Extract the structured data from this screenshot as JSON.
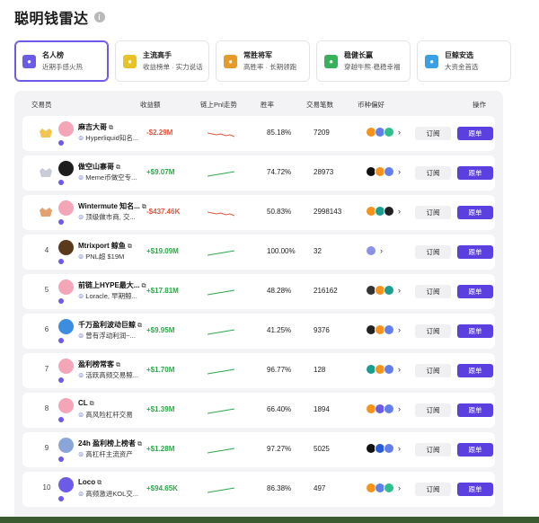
{
  "title": "聪明钱雷达",
  "info_icon": "i",
  "categories": [
    {
      "title": "名人榜",
      "subtitle": "近期手感火热",
      "icon": "user-badge-icon",
      "color": "#6b5be6",
      "active": true
    },
    {
      "title": "主流高手",
      "subtitle": "收益榜单 · 实力说话",
      "icon": "coin-icon",
      "color": "#e7c329",
      "active": false
    },
    {
      "title": "常胜将军",
      "subtitle": "高胜率 · 长期领跑",
      "icon": "trophy-icon",
      "color": "#e59a2a",
      "active": false
    },
    {
      "title": "稳健长赢",
      "subtitle": "穿越牛熊·稳稳幸福",
      "icon": "chart-up-icon",
      "color": "#38b25a",
      "active": false
    },
    {
      "title": "巨鲸安选",
      "subtitle": "大资金首选",
      "icon": "whale-icon",
      "color": "#3aa0e6",
      "active": false
    }
  ],
  "columns": {
    "trader": "交易员",
    "pnl": "收益额",
    "trend": "链上Pnl走势",
    "winrate": "胜率",
    "trades": "交易笔数",
    "coins": "币种偏好",
    "action": "操作"
  },
  "buttons": {
    "subscribe": "订阅",
    "follow": "跟单"
  },
  "rows": [
    {
      "rank": "",
      "medal": "gold",
      "name": "麻吉大哥",
      "desc": "Hyperliquid知名...",
      "pnl": "-$2.29M",
      "sign": "neg",
      "winrate": "85.18%",
      "trades": "7209",
      "avatar": "#f4a6b8",
      "coins": [
        "#f7931a",
        "#627eea",
        "#2fbf8a"
      ]
    },
    {
      "rank": "",
      "medal": "silver",
      "name": "做空山寨哥",
      "desc": "Meme币做空专...",
      "pnl": "+$9.07M",
      "sign": "pos",
      "winrate": "74.72%",
      "trades": "28973",
      "avatar": "#1d1d1d",
      "coins": [
        "#111111",
        "#f7931a",
        "#627eea"
      ]
    },
    {
      "rank": "",
      "medal": "bronze",
      "name": "Wintermute 知名...",
      "desc": "顶级做市商, 交...",
      "pnl": "-$437.46K",
      "sign": "neg",
      "winrate": "50.83%",
      "trades": "2998143",
      "avatar": "#f4a6b8",
      "coins": [
        "#f7931a",
        "#1a9e8f",
        "#222222"
      ]
    },
    {
      "rank": "4",
      "medal": "",
      "name": "Mtrixport 鲸鱼",
      "desc": "PNL超 $19M",
      "pnl": "+$19.09M",
      "sign": "pos",
      "winrate": "100.00%",
      "trades": "32",
      "avatar": "#5a3a1a",
      "coins": [
        "#8a93e8"
      ]
    },
    {
      "rank": "5",
      "medal": "",
      "name": "前链上HYPE最大...",
      "desc": "Loracle, 早期鲸...",
      "pnl": "+$17.81M",
      "sign": "pos",
      "winrate": "48.28%",
      "trades": "216162",
      "avatar": "#f4a6b8",
      "coins": [
        "#333333",
        "#f7931a",
        "#1a9e8f"
      ]
    },
    {
      "rank": "6",
      "medal": "",
      "name": "千万盈利波动巨鲸",
      "desc": "曾有浮动利润~...",
      "pnl": "+$9.95M",
      "sign": "pos",
      "winrate": "41.25%",
      "trades": "9376",
      "avatar": "#3b8de0",
      "coins": [
        "#222222",
        "#f7931a",
        "#627eea"
      ]
    },
    {
      "rank": "7",
      "medal": "",
      "name": "盈利榜常客",
      "desc": "活跃高频交易鲸...",
      "pnl": "+$1.70M",
      "sign": "pos",
      "winrate": "96.77%",
      "trades": "128",
      "avatar": "#f4a6b8",
      "coins": [
        "#1a9e8f",
        "#f7931a",
        "#627eea"
      ]
    },
    {
      "rank": "8",
      "medal": "",
      "name": "CL",
      "desc": "高风险杠杆交易",
      "pnl": "+$1.39M",
      "sign": "pos",
      "winrate": "66.40%",
      "trades": "1894",
      "avatar": "#f4a6b8",
      "coins": [
        "#f7931a",
        "#6b5be6",
        "#627eea"
      ]
    },
    {
      "rank": "9",
      "medal": "",
      "name": "24h 盈利榜上榜者",
      "desc": "高杠杆主流资产",
      "pnl": "+$1.28M",
      "sign": "pos",
      "winrate": "97.27%",
      "trades": "5025",
      "avatar": "#8aa6d8",
      "coins": [
        "#111111",
        "#2a5bd7",
        "#627eea"
      ]
    },
    {
      "rank": "10",
      "medal": "",
      "name": "Loco",
      "desc": "高频激进KOL交...",
      "pnl": "+$94.65K",
      "sign": "pos",
      "winrate": "86.38%",
      "trades": "497",
      "avatar": "#6b5be6",
      "coins": [
        "#f7931a",
        "#627eea",
        "#2fbf8a"
      ]
    }
  ]
}
